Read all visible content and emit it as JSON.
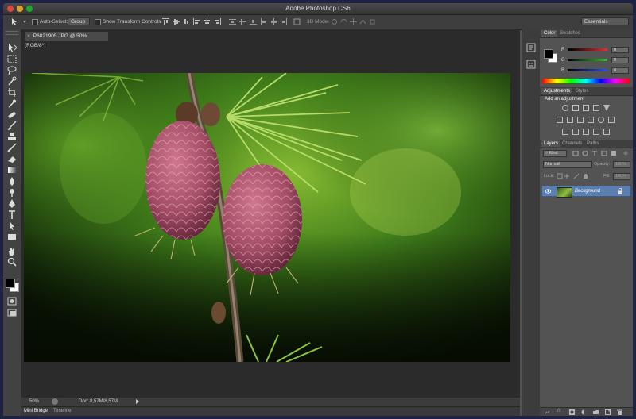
{
  "window": {
    "title": "Adobe Photoshop CS6"
  },
  "options_bar": {
    "auto_select_label": "Auto-Select:",
    "auto_select_value": "Group",
    "show_transform_label": "Show Transform Controls",
    "mode_3d_label": "3D Mode:",
    "workspace_value": "Essentials"
  },
  "document": {
    "tab_label": "P6021905.JPG @ 50% (RGB/8*)",
    "close_glyph": "×"
  },
  "status_bar": {
    "zoom": "50%",
    "doc_info": "Doc: 8,57M/8,57M"
  },
  "bottom_tabs": [
    "Mini Bridge",
    "Timeline"
  ],
  "color_panel": {
    "tabs": [
      "Color",
      "Swatches"
    ],
    "rows": [
      {
        "channel": "R",
        "value": "0",
        "color": "#e03030"
      },
      {
        "channel": "G",
        "value": "0",
        "color": "#30c030"
      },
      {
        "channel": "B",
        "value": "0",
        "color": "#3050e0"
      }
    ]
  },
  "adjustments_panel": {
    "tabs": [
      "Adjustments",
      "Styles"
    ],
    "heading": "Add an adjustment"
  },
  "layers_panel": {
    "tabs": [
      "Layers",
      "Channels",
      "Paths"
    ],
    "filter_kind": "Kind",
    "blend_mode": "Normal",
    "opacity_label": "Opacity:",
    "opacity_value": "100%",
    "lock_label": "Lock:",
    "fill_label": "Fill:",
    "fill_value": "100%",
    "layer_name": "Background"
  },
  "colors": {
    "accent": "#5b7fb0",
    "foreground": "#000000",
    "background": "#ffffff"
  }
}
